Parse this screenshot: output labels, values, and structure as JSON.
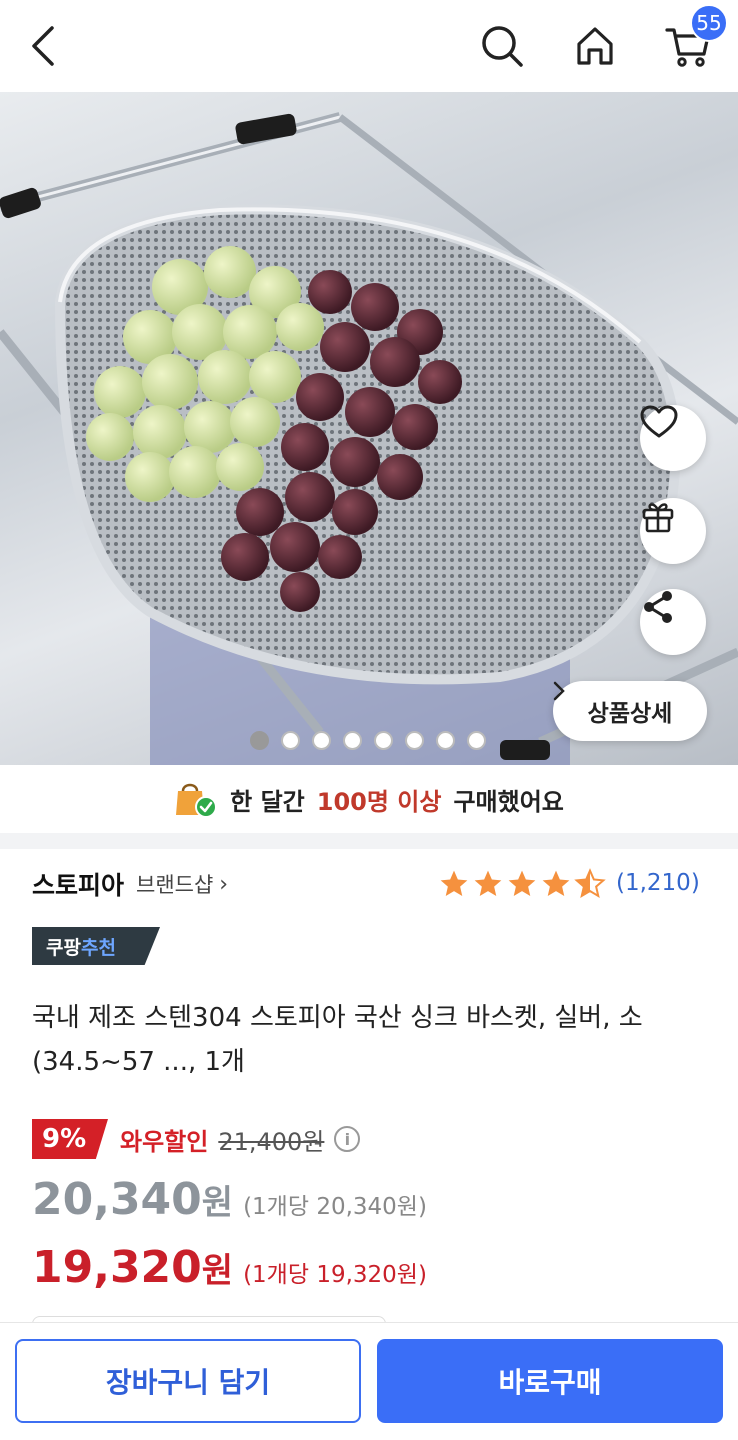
{
  "header": {
    "cart_count": "55",
    "icons": [
      "back-arrow-icon",
      "search-icon",
      "home-icon",
      "cart-icon"
    ]
  },
  "gallery": {
    "detail_label": "상품상세",
    "page_count": 8,
    "current_page": 1,
    "side_icons": [
      "heart-icon",
      "gift-icon",
      "share-icon"
    ]
  },
  "banner": {
    "prefix": "한 달간",
    "highlight": "100명 이상",
    "suffix": "구매했어요"
  },
  "product": {
    "brand": "스토피아",
    "brand_shop": "브랜드샵",
    "rating": 4.5,
    "rating_count": "(1,210)",
    "badge_part1": "쿠팡",
    "badge_part2": "추천",
    "title": "국내 제조 스텐304 스토피아 국산 싱크 바스켓, 실버, 소(34.5~57 ..., 1개"
  },
  "price": {
    "discount_rate": "9%",
    "discount_label": "와우할인",
    "original_price": "21,400원",
    "sale_amount": "20,340",
    "sale_won": "원",
    "sale_unit": "(1개당 20,340원)",
    "wow_amount": "19,320",
    "wow_won": "원",
    "wow_unit": "(1개당 19,320원)"
  },
  "actions": {
    "add_to_cart": "장바구니 담기",
    "buy_now": "바로구매"
  },
  "colors": {
    "accent_blue": "#3a6ef7",
    "sale_red": "#d42027",
    "star_orange": "#f5913e"
  }
}
